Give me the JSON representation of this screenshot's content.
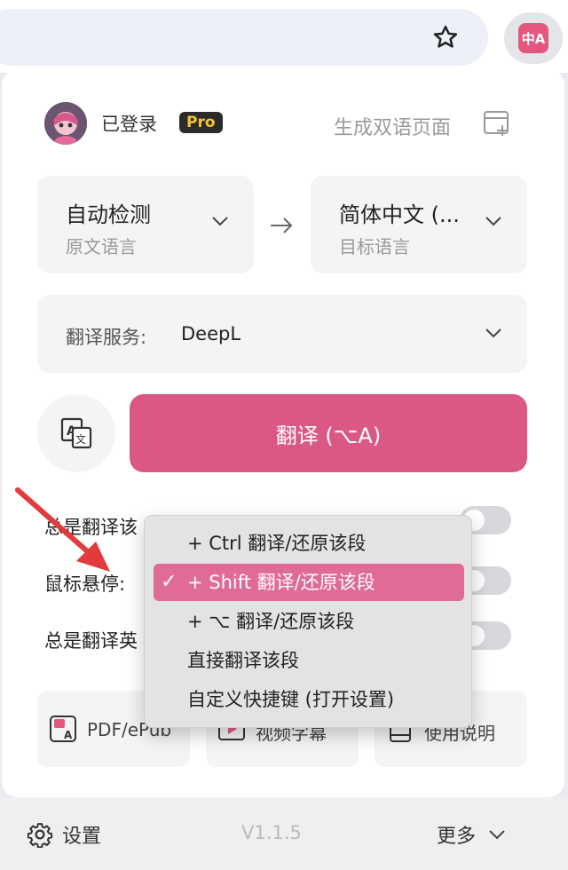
{
  "browser": {
    "extension_logo": "中A"
  },
  "header": {
    "login_status": "已登录",
    "pro_badge": "Pro",
    "bilingual_page": "生成双语页面"
  },
  "languages": {
    "source": {
      "value": "自动检测",
      "label": "原文语言"
    },
    "target": {
      "value": "简体中文 (...",
      "label": "目标语言"
    }
  },
  "service": {
    "label": "翻译服务:",
    "value": "DeepL"
  },
  "translate_button": "翻译 (⌥A)",
  "rows": [
    {
      "label": "总是翻译该"
    },
    {
      "label": "鼠标悬停:"
    },
    {
      "label": "总是翻译英"
    }
  ],
  "dropdown": {
    "items": [
      {
        "label": "+ Ctrl 翻译/还原该段",
        "selected": false
      },
      {
        "label": "+ Shift 翻译/还原该段",
        "selected": true
      },
      {
        "label": "+ ⌥ 翻译/还原该段",
        "selected": false
      },
      {
        "label": "直接翻译该段",
        "selected": false
      },
      {
        "label": "自定义快捷键 (打开设置)",
        "selected": false
      }
    ]
  },
  "tools": [
    {
      "label": "PDF/ePub",
      "icon": "pdf-translate-icon"
    },
    {
      "label": "视频字幕",
      "icon": "video-subtitle-icon"
    },
    {
      "label": "使用说明",
      "icon": "manual-icon"
    }
  ],
  "footer": {
    "settings": "设置",
    "version": "V1.1.5",
    "more": "更多"
  },
  "colors": {
    "accent": "#db5886",
    "menu_selected": "#e06b96",
    "annotation_arrow": "#e23b3b"
  }
}
